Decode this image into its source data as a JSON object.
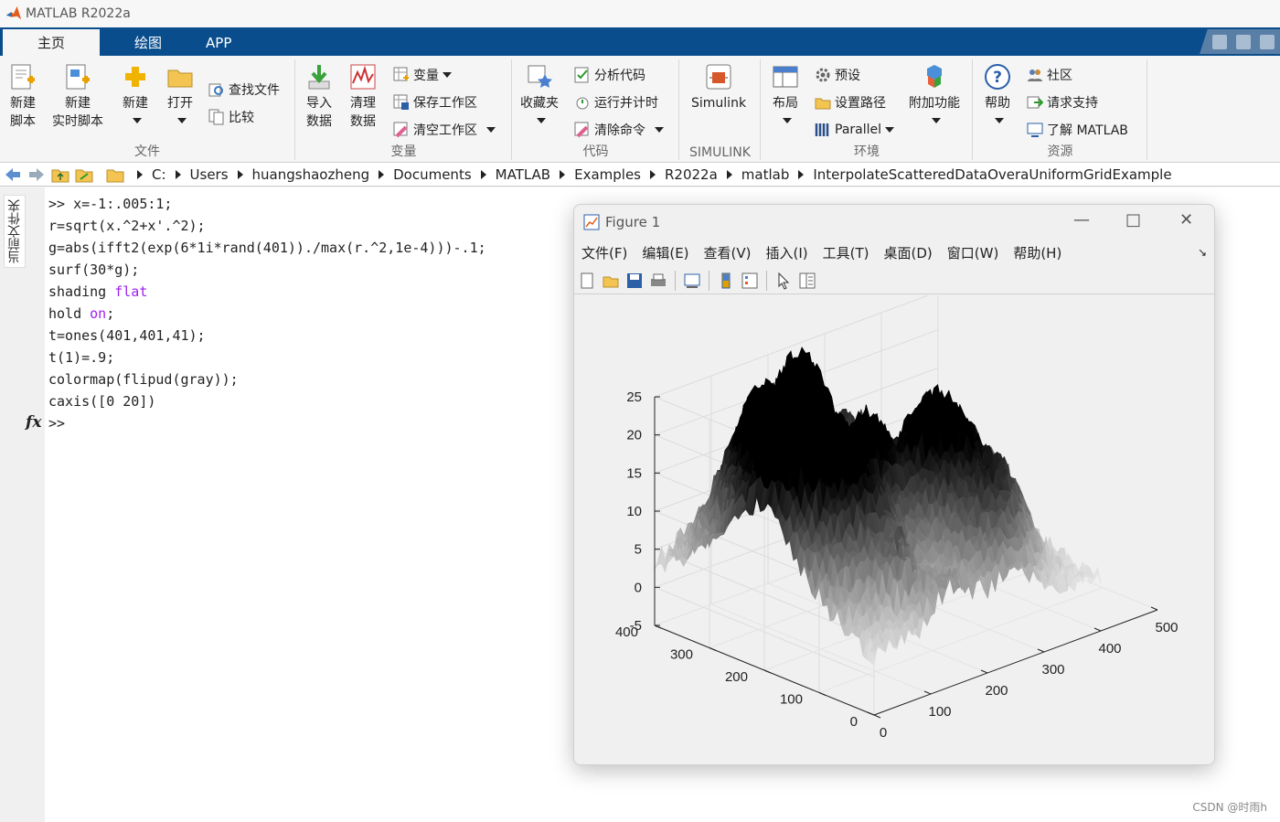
{
  "app": {
    "title": "MATLAB R2022a"
  },
  "tabs": [
    {
      "label": "主页"
    },
    {
      "label": "绘图"
    },
    {
      "label": "APP"
    }
  ],
  "ribbon": {
    "file": {
      "label": "文件",
      "new_script": [
        "新建",
        "脚本"
      ],
      "new_live": [
        "新建",
        "实时脚本"
      ],
      "new": "新建",
      "open": "打开",
      "find_files": "查找文件",
      "compare": "比较"
    },
    "variable": {
      "label": "变量",
      "import": [
        "导入",
        "数据"
      ],
      "clean": [
        "清理",
        "数据"
      ],
      "variable": "变量",
      "save_ws": "保存工作区",
      "clear_ws": "清空工作区"
    },
    "code": {
      "label": "代码",
      "favorites": "收藏夹",
      "analyze": "分析代码",
      "run_time": "运行并计时",
      "clear_cmds": "清除命令"
    },
    "simulink": {
      "label": "SIMULINK",
      "button": "Simulink"
    },
    "env": {
      "label": "环境",
      "layout": "布局",
      "prefs": "预设",
      "set_path": "设置路径",
      "parallel": "Parallel",
      "addons": "附加功能"
    },
    "resources": {
      "label": "资源",
      "help": "帮助",
      "community": "社区",
      "support": "请求支持",
      "learn": "了解 MATLAB"
    }
  },
  "path": {
    "segments": [
      "C:",
      "Users",
      "huangshaozheng",
      "Documents",
      "MATLAB",
      "Examples",
      "R2022a",
      "matlab",
      "InterpolateScatteredDataOveraUniformGridExample"
    ]
  },
  "side_panel": {
    "label": "当前文件夹"
  },
  "command_window": {
    "lines": [
      {
        "pre": ">> x=-1:.005:1;",
        "kw": "",
        "post": ""
      },
      {
        "pre": "r=sqrt(x.^2+x'.^2);",
        "kw": "",
        "post": ""
      },
      {
        "pre": "g=abs(ifft2(exp(6*1i*rand(401))./max(r.^2,1e-4)))-.1;",
        "kw": "",
        "post": ""
      },
      {
        "pre": "surf(30*g);",
        "kw": "",
        "post": ""
      },
      {
        "pre": "shading ",
        "kw": "flat",
        "post": ""
      },
      {
        "pre": "hold ",
        "kw": "on",
        "post": ";"
      },
      {
        "pre": "t=ones(401,401,41);",
        "kw": "",
        "post": ""
      },
      {
        "pre": "t(1)=.9;",
        "kw": "",
        "post": ""
      },
      {
        "pre": "colormap(flipud(gray));",
        "kw": "",
        "post": ""
      },
      {
        "pre": "caxis([0 20])",
        "kw": "",
        "post": ""
      }
    ],
    "prompt": ">>",
    "fx": "fx"
  },
  "figure": {
    "title": "Figure 1",
    "menu": [
      "文件(F)",
      "编辑(E)",
      "查看(V)",
      "插入(I)",
      "工具(T)",
      "桌面(D)",
      "窗口(W)",
      "帮助(H)"
    ],
    "chart_data": {
      "type": "surface",
      "z_ticks": [
        "25",
        "20",
        "15",
        "10",
        "5",
        "0",
        "-5"
      ],
      "y_ticks": [
        "400",
        "300",
        "200",
        "100",
        "0"
      ],
      "x_ticks": [
        "0",
        "100",
        "200",
        "300",
        "400",
        "500"
      ],
      "xlim": [
        0,
        500
      ],
      "ylim": [
        0,
        400
      ],
      "zlim": [
        -5,
        25
      ],
      "colormap": "flipud(gray)",
      "clim": [
        0,
        20
      ],
      "grid": "on"
    }
  },
  "watermark": "CSDN @时雨h"
}
